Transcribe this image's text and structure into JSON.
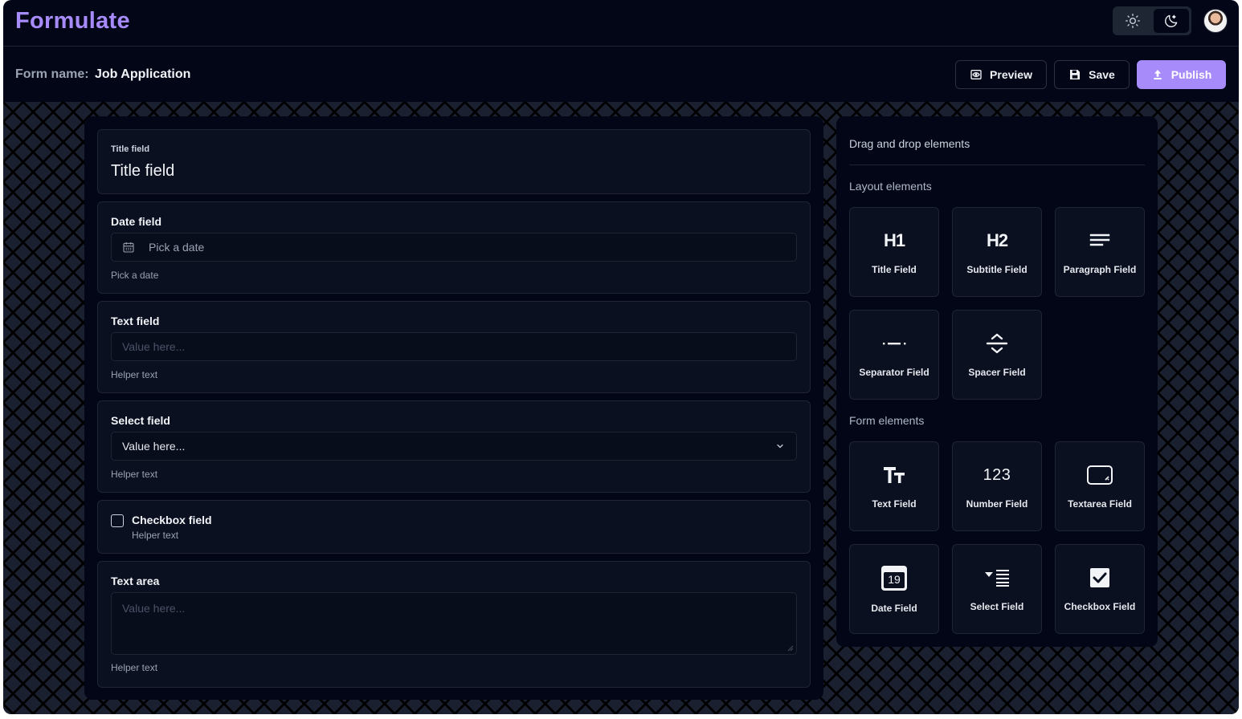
{
  "app": {
    "name": "Formulate"
  },
  "header": {
    "form_name_label": "Form name:",
    "form_name_value": "Job Application"
  },
  "actions": {
    "preview": "Preview",
    "save": "Save",
    "publish": "Publish"
  },
  "colors": {
    "accent": "#a78bfa",
    "background": "#020617",
    "card": "#0a1020",
    "border": "#1e2533"
  },
  "designer": {
    "title_field": {
      "label": "Title field",
      "value": "Title field"
    },
    "date_field": {
      "label": "Date field",
      "placeholder": "Pick a date",
      "helper": "Pick a date"
    },
    "text_field": {
      "label": "Text field",
      "placeholder": "Value here...",
      "helper": "Helper text"
    },
    "select_field": {
      "label": "Select field",
      "value": "Value here...",
      "helper": "Helper text"
    },
    "checkbox_field": {
      "label": "Checkbox field",
      "helper": "Helper text"
    },
    "text_area": {
      "label": "Text area",
      "placeholder": "Value here...",
      "helper": "Helper text"
    }
  },
  "toolbox": {
    "title": "Drag and drop elements",
    "layout_title": "Layout elements",
    "form_title": "Form elements",
    "layout_items": [
      {
        "label": "Title Field",
        "icon": "heading-1-icon",
        "glyph": "H1"
      },
      {
        "label": "Subtitle Field",
        "icon": "heading-2-icon",
        "glyph": "H2"
      },
      {
        "label": "Paragraph Field",
        "icon": "paragraph-icon"
      },
      {
        "label": "Separator Field",
        "icon": "separator-icon"
      },
      {
        "label": "Spacer Field",
        "icon": "spacer-icon"
      }
    ],
    "form_items": [
      {
        "label": "Text Field",
        "icon": "text-icon"
      },
      {
        "label": "Number Field",
        "icon": "number-icon",
        "glyph": "123"
      },
      {
        "label": "Textarea Field",
        "icon": "textarea-icon"
      },
      {
        "label": "Date Field",
        "icon": "calendar-icon",
        "glyph": "19"
      },
      {
        "label": "Select Field",
        "icon": "select-list-icon"
      },
      {
        "label": "Checkbox Field",
        "icon": "checkbox-icon"
      }
    ]
  }
}
